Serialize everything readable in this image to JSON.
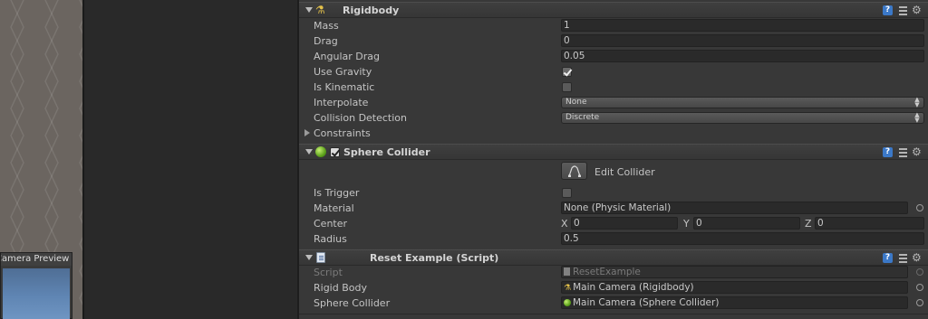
{
  "scene": {
    "camera_preview_title": "Camera Preview"
  },
  "rigidbody": {
    "title": "Rigidbody",
    "mass_label": "Mass",
    "mass_value": "1",
    "drag_label": "Drag",
    "drag_value": "0",
    "angular_drag_label": "Angular Drag",
    "angular_drag_value": "0.05",
    "use_gravity_label": "Use Gravity",
    "use_gravity_checked": true,
    "is_kinematic_label": "Is Kinematic",
    "is_kinematic_checked": false,
    "interpolate_label": "Interpolate",
    "interpolate_value": "None",
    "collision_detection_label": "Collision Detection",
    "collision_detection_value": "Discrete",
    "constraints_label": "Constraints"
  },
  "sphere_collider": {
    "title": "Sphere Collider",
    "enabled": true,
    "edit_collider_label": "Edit Collider",
    "is_trigger_label": "Is Trigger",
    "is_trigger_checked": false,
    "material_label": "Material",
    "material_value": "None (Physic Material)",
    "center_label": "Center",
    "center_x_label": "X",
    "center_x": "0",
    "center_y_label": "Y",
    "center_y": "0",
    "center_z_label": "Z",
    "center_z": "0",
    "radius_label": "Radius",
    "radius_value": "0.5"
  },
  "reset_example": {
    "title": "Reset Example (Script)",
    "script_label": "Script",
    "script_value": "ResetExample",
    "rigid_body_label": "Rigid Body",
    "rigid_body_value": "Main Camera (Rigidbody)",
    "sphere_collider_label": "Sphere Collider",
    "sphere_collider_value": "Main Camera (Sphere Collider)"
  },
  "icons": {
    "help": "help-icon",
    "preset": "preset-icon",
    "gear": "gear-icon"
  },
  "colors": {
    "inspector_bg": "#383838",
    "field_bg": "#2a2a2a",
    "help_icon": "#3b78c7",
    "collider_green": "#5da11c"
  }
}
